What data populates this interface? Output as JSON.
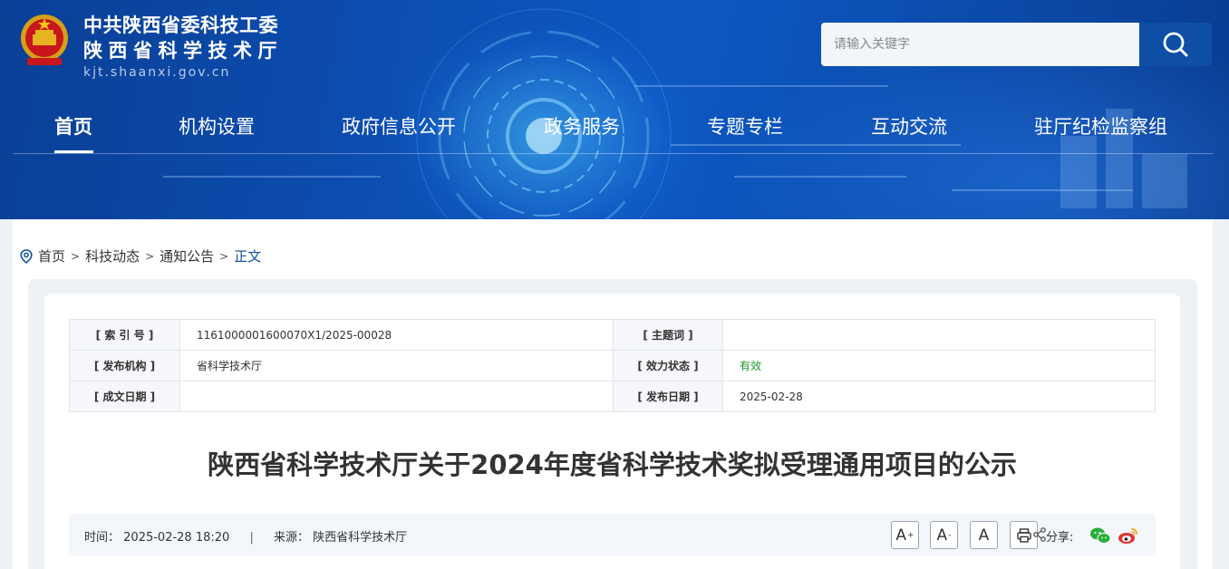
{
  "header": {
    "site_name_line1": "中共陕西省委科技工委",
    "site_name_line2": "陕西省科学技术厅",
    "domain": "kjt.shaanxi.gov.cn",
    "logo_icon": "national-emblem-icon"
  },
  "search": {
    "placeholder": "请输入关键字",
    "value": "",
    "button_icon": "search-icon"
  },
  "nav": {
    "items": [
      {
        "label": "首页",
        "active": true
      },
      {
        "label": "机构设置"
      },
      {
        "label": "政府信息公开"
      },
      {
        "label": "政务服务"
      },
      {
        "label": "专题专栏"
      },
      {
        "label": "互动交流"
      },
      {
        "label": "驻厅纪检监察组"
      }
    ]
  },
  "breadcrumb": {
    "items": [
      "首页",
      "科技动态",
      "通知公告",
      "正文"
    ],
    "separator": ">"
  },
  "meta": {
    "index_label": "[ 索 引 号 ]",
    "index_value": "1161000001600070X1/2025-00028",
    "keyword_label": "[ 主题词 ]",
    "keyword_value": "",
    "publisher_label": "[ 发布机构 ]",
    "publisher_value": "省科学技术厅",
    "status_label": "[ 效力状态 ]",
    "status_value": "有效",
    "created_label": "[ 成文日期 ]",
    "created_value": "",
    "pubdate_label": "[ 发布日期 ]",
    "pubdate_value": "2025-02-28",
    "status_color": "#1a9a2a"
  },
  "article": {
    "title": "陕西省科学技术厅关于2024年度省科学技术奖拟受理通用项目的公示",
    "time_label": "时间：",
    "time_value": "2025-02-28 18:20",
    "divider": "|",
    "source_label": "来源：",
    "source_value": "陕西省科学技术厅"
  },
  "tools": {
    "font_larger": "A",
    "font_smaller": "A",
    "font_normal": "A",
    "plus": "+",
    "minus": "-",
    "share_label": "分享:"
  },
  "colors": {
    "header_blue": "#0c4fb3",
    "search_button": "#0e4fa5",
    "breadcrumb_current": "#0f4f9f",
    "wechat_green": "#2aae3a",
    "weibo_red": "#e0342f"
  }
}
